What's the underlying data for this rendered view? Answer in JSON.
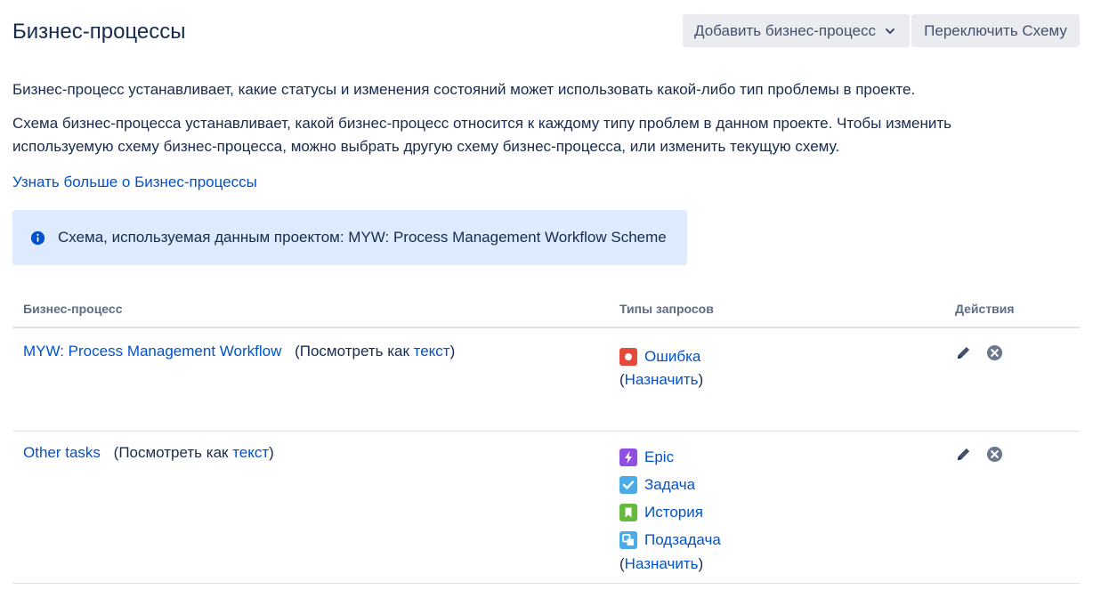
{
  "page": {
    "title": "Бизнес-процессы",
    "description1": "Бизнес-процесс устанавливает, какие статусы и изменения состояний может использовать какой-либо тип проблемы в проекте.",
    "description2": "Схема бизнес-процесса устанавливает, какой бизнес-процесс относится к каждому типу проблем в данном проекте. Чтобы изменить используемую схему бизнес-процесса, можно выбрать другую схему бизнес-процесса, или изменить текущую схему.",
    "learn_more": "Узнать больше о Бизнес-процессы"
  },
  "toolbar": {
    "add_label": "Добавить бизнес-процесс",
    "switch_label": "Переключить Схему"
  },
  "info": {
    "text": "Схема, используемая данным проектом: MYW: Process Management Workflow Scheme",
    "icon": "info-circle-icon",
    "color": "#deebff"
  },
  "table": {
    "headers": {
      "name": "Бизнес-процесс",
      "types": "Типы запросов",
      "actions": "Действия"
    },
    "rows": [
      {
        "name": "MYW: Process Management Workflow",
        "view_prefix": "(Посмотреть как ",
        "view_link": "текст",
        "view_suffix": ")",
        "types": [
          {
            "label": "Ошибка",
            "icon": "bug-icon",
            "color": "#e5493a"
          }
        ],
        "assign_open": "(",
        "assign_link": "Назначить",
        "assign_close": ")"
      },
      {
        "name": "Other tasks",
        "view_prefix": "(Посмотреть как ",
        "view_link": "текст",
        "view_suffix": ")",
        "types": [
          {
            "label": "Epic",
            "icon": "epic-icon",
            "color": "#904ee2"
          },
          {
            "label": "Задача",
            "icon": "task-icon",
            "color": "#4bade8"
          },
          {
            "label": "История",
            "icon": "story-icon",
            "color": "#63ba3c"
          },
          {
            "label": "Подзадача",
            "icon": "subtask-icon",
            "color": "#4bade8"
          }
        ],
        "assign_open": "(",
        "assign_link": "Назначить",
        "assign_close": ")"
      }
    ]
  },
  "colors": {
    "link": "#0052cc",
    "text": "#172b4d",
    "button_bg": "#ebecf0"
  }
}
